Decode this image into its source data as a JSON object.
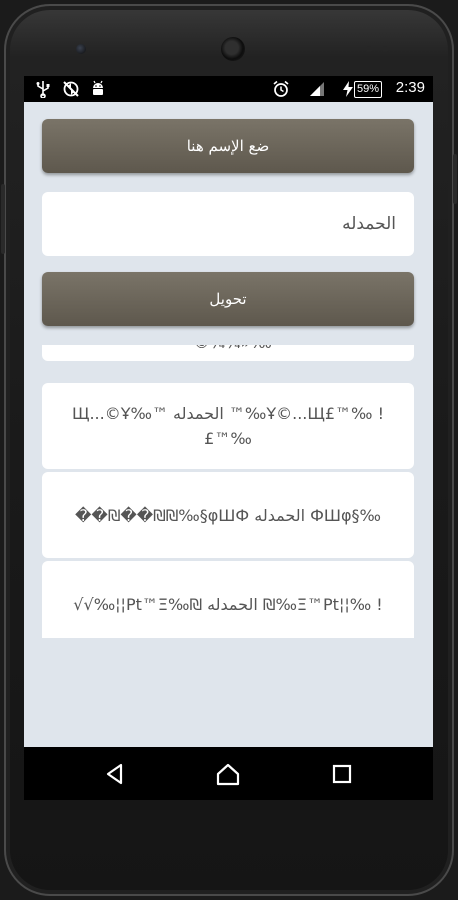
{
  "statusbar": {
    "battery": "59%",
    "time": "2:39",
    "left_icons": [
      "usb-icon",
      "no-sync-icon",
      "android-debug-icon"
    ],
    "right_icons": [
      "alarm-icon",
      "signal-icon",
      "charging-bolt-icon",
      "battery-icon"
    ]
  },
  "app": {
    "name_button": "ضع الإسم هنا",
    "input_value": "الحمدله",
    "convert_button": "تحويل"
  },
  "results": [
    "￼￼‰«¼¾©•",
    "! ‰™£Ұ©...Щ‰™ الحمدله ™‰Щ...©Ұ ‰™£",
    "‰§ФШφ الحمدله φШФ§‰₪￼₪￼��￼₪￼��",
    "! ‰￼¦¦￼Ξ™Pt‰₪ الحمدله ₪‰Pt™Ξ￼¦¦￼‰√√"
  ],
  "navbar": [
    "back-icon",
    "home-icon",
    "recents-icon"
  ]
}
